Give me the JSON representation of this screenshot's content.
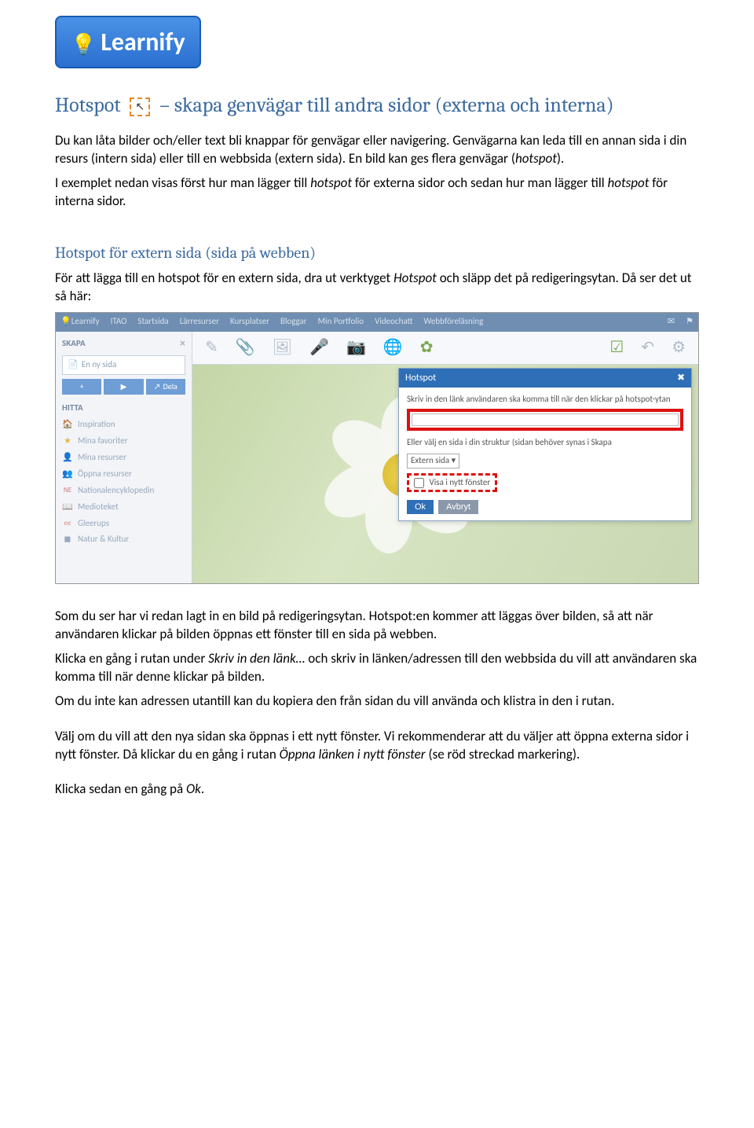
{
  "logo": "Learnify",
  "title_prefix": "Hotspot",
  "title_rest": " – skapa genvägar till andra sidor (externa och interna)",
  "intro_p1": "Du kan låta bilder och/eller text bli knappar för genvägar eller navigering. Genvägarna kan leda till en annan sida i din resurs (intern sida) eller till en webbsida (extern sida). En bild kan ges flera genvägar (",
  "intro_p1_i": "hotspot",
  "intro_p1_end": ").",
  "intro_p2a": "I exemplet nedan visas först hur man lägger till ",
  "intro_p2_i1": "hotspot",
  "intro_p2b": " för externa sidor och sedan hur man lägger till ",
  "intro_p2_i2": "hotspot",
  "intro_p2c": " för interna sidor.",
  "subtitle": "Hotspot för extern sida (sida på webben)",
  "sub_p_a": "För att lägga till en hotspot för en extern sida, dra ut verktyget ",
  "sub_p_i": "Hotspot",
  "sub_p_b": " och släpp det på redigeringsytan. Då ser det ut så här:",
  "nav": {
    "brand": "Learnify",
    "items": [
      "ITAO",
      "Startsida",
      "Lärresurser",
      "Kursplatser",
      "Bloggar",
      "Min Portfolio",
      "Videochatt",
      "Webbföreläsning"
    ]
  },
  "sidebar": {
    "skapa": "SKAPA",
    "newpage": "En ny sida",
    "dela": "Dela",
    "hitta": "HITTA",
    "items": [
      {
        "icon": "🏠",
        "label": "Inspiration"
      },
      {
        "icon": "★",
        "label": "Mina favoriter"
      },
      {
        "icon": "👤",
        "label": "Mina resurser"
      },
      {
        "icon": "👥",
        "label": "Öppna resurser"
      },
      {
        "icon": "NE",
        "label": "Nationalencyklopedin"
      },
      {
        "icon": "📖",
        "label": "Medioteket"
      },
      {
        "icon": "ee",
        "label": "Gleerups"
      },
      {
        "icon": "◼",
        "label": "Natur & Kultur"
      }
    ]
  },
  "dialog": {
    "title": "Hotspot",
    "label1": "Skriv in den länk användaren ska komma till när den klickar på hotspot-ytan",
    "label2": "Eller välj en sida i din struktur (sidan behöver synas i Skapa",
    "select": "Extern sida",
    "checkbox": "Visa i nytt fönster",
    "ok": "Ok",
    "cancel": "Avbryt"
  },
  "after_p1": "Som du ser har vi redan lagt in en bild på redigeringsytan. Hotspot:en kommer att läggas över bilden, så att när användaren klickar på bilden öppnas ett fönster till en sida på webben.",
  "after_p2a": "Klicka en gång i rutan under ",
  "after_p2_i": "Skriv in den länk…",
  "after_p2b": " och skriv in länken/adressen till den webbsida du vill att användaren ska komma till när denne klickar på bilden.",
  "after_p3": "Om du inte kan adressen utantill kan du kopiera den från sidan du vill använda och klistra in den i rutan.",
  "after_p4a": "Välj om du vill att den nya sidan ska öppnas i ett nytt fönster. Vi rekommenderar att du väljer att öppna externa sidor i nytt fönster. Då klickar du en gång i rutan ",
  "after_p4_i": "Öppna länken i nytt fönster",
  "after_p4b": " (se röd streckad markering).",
  "after_p5a": "Klicka sedan en gång på ",
  "after_p5_i": "Ok",
  "after_p5b": "."
}
